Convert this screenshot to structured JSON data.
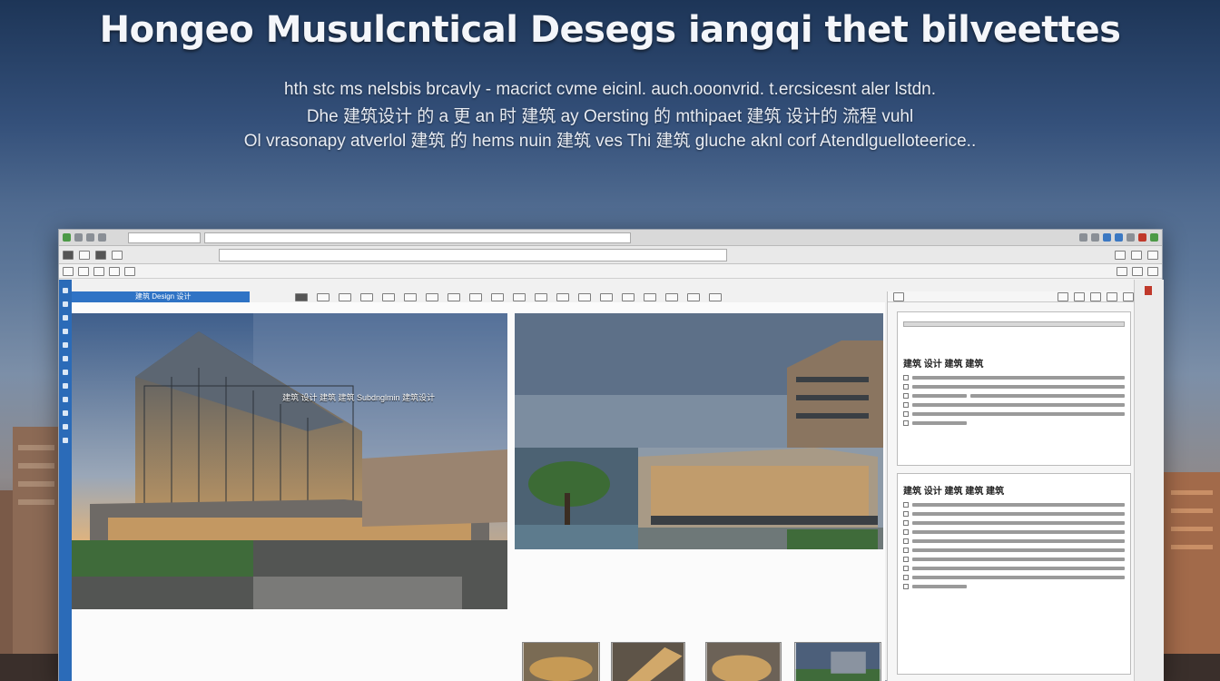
{
  "headline": "Hongeo Musulcntical Desegs iangqi thet bilveettes",
  "subtitle_lines": [
    "hth stc ms nelsbis brcavly - macrict cvme eicinl. auch.ooonvrid. t.ercsicesnt aler lstdn.",
    "Dhe 建筑设计 的 a 更 an 时 建筑 ay Oersting 的 mthipaet 建筑 设计的 流程 vuhl",
    "Ol vrasonapy atverlol 建筑 的 hems nuin 建筑 ves Thi 建筑 gluche aknl corf Atendlguelloteerice.."
  ],
  "app": {
    "document_tab": "建筑 Design 设计",
    "panel_caption": "建筑 设计 建筑 建筑 Subdnglmin 建筑设计",
    "properties": {
      "section1_title": "建筑 设计 建筑 建筑",
      "section2_title": "建筑 设计 建筑 建筑 建筑"
    }
  },
  "colors": {
    "accent_blue": "#2b6bb8",
    "window_bg": "#f1f1f1",
    "sky_top": "#1d3557"
  },
  "icons": [
    "window-control-icon",
    "toolbar-tool-icon",
    "checkbox-icon"
  ]
}
